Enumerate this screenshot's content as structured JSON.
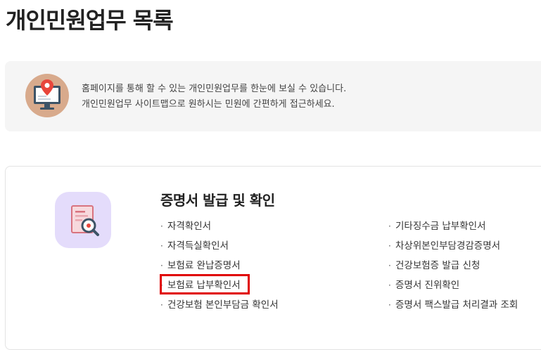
{
  "page": {
    "title": "개인민원업무 목록"
  },
  "info": {
    "line1": "홈페이지를 통해 할 수 있는 개인민원업무를 한눈에 보실 수 있습니다.",
    "line2": "개인민원업무 사이트맵으로 원하시는 민원에 간편하게 접근하세요."
  },
  "category": {
    "title": "증명서 발급 및 확인",
    "left_items": [
      "자격확인서",
      "자격득실확인서",
      "보험료 완납증명서",
      "보험료 납부확인서",
      "건강보험 본인부담금 확인서"
    ],
    "right_items": [
      "기타징수금 납부확인서",
      "차상위본인부담경감증명서",
      "건강보험증 발급 신청",
      "증명서 진위확인",
      "증명서 팩스발급 처리결과 조회"
    ],
    "highlighted_item": "보험료 납부확인서"
  },
  "colors": {
    "info_bg": "#f5f5f5",
    "icon_circle": "#d8aa8c",
    "category_icon_bg": "#e4dcfb",
    "highlight": "#e00000"
  }
}
